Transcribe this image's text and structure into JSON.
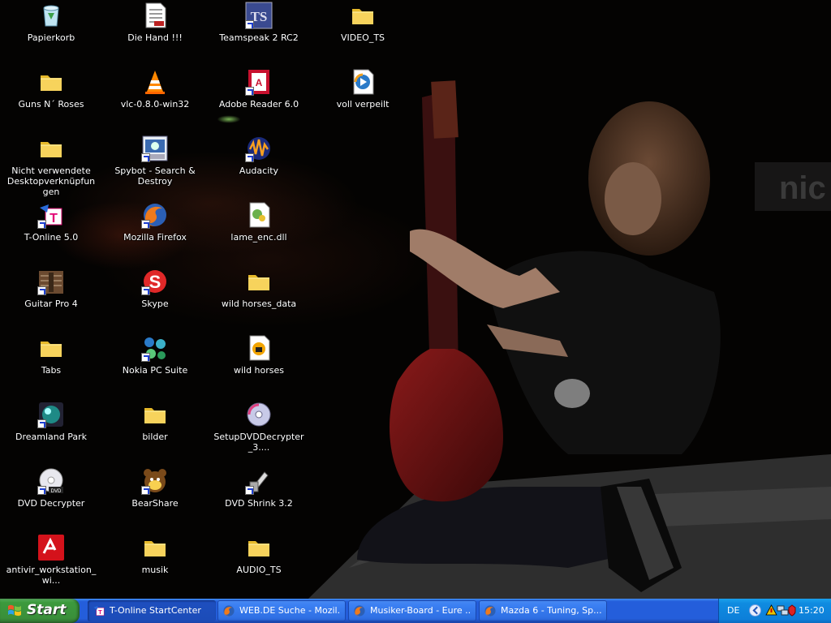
{
  "desktop": {
    "icons": [
      {
        "id": "papierkorb",
        "label": "Papierkorb",
        "icon": "recycle-bin-icon"
      },
      {
        "id": "guns-n-roses",
        "label": "Guns N´ Roses",
        "icon": "folder-icon"
      },
      {
        "id": "nicht-verwendete",
        "label": "Nicht verwendete Desktopverknüpfungen",
        "icon": "folder-icon"
      },
      {
        "id": "t-online",
        "label": "T-Online 5.0",
        "icon": "t-online-icon"
      },
      {
        "id": "guitar-pro",
        "label": "Guitar Pro 4",
        "icon": "guitar-pro-icon"
      },
      {
        "id": "tabs",
        "label": "Tabs",
        "icon": "folder-icon"
      },
      {
        "id": "dreamland-park",
        "label": "Dreamland Park",
        "icon": "game-icon"
      },
      {
        "id": "dvd-decrypter",
        "label": "DVD Decrypter",
        "icon": "dvd-icon"
      },
      {
        "id": "antivir",
        "label": "antivir_workstation_wi...",
        "icon": "antivir-icon"
      },
      {
        "id": "die-hand",
        "label": "Die Hand !!!",
        "icon": "document-icon"
      },
      {
        "id": "vlc",
        "label": "vlc-0.8.0-win32",
        "icon": "vlc-cone-icon"
      },
      {
        "id": "spybot",
        "label": "Spybot - Search & Destroy",
        "icon": "spybot-icon"
      },
      {
        "id": "firefox",
        "label": "Mozilla Firefox",
        "icon": "firefox-icon"
      },
      {
        "id": "skype",
        "label": "Skype",
        "icon": "skype-icon"
      },
      {
        "id": "nokia",
        "label": "Nokia PC Suite",
        "icon": "nokia-icon"
      },
      {
        "id": "bilder",
        "label": "bilder",
        "icon": "folder-icon"
      },
      {
        "id": "bearshare",
        "label": "BearShare",
        "icon": "bearshare-icon"
      },
      {
        "id": "musik",
        "label": "musik",
        "icon": "folder-icon"
      },
      {
        "id": "teamspeak",
        "label": "Teamspeak 2 RC2",
        "icon": "teamspeak-icon"
      },
      {
        "id": "adobe-reader",
        "label": "Adobe Reader 6.0",
        "icon": "adobe-reader-icon"
      },
      {
        "id": "audacity",
        "label": "Audacity",
        "icon": "audacity-icon"
      },
      {
        "id": "lame-enc",
        "label": "lame_enc.dll",
        "icon": "dll-file-icon"
      },
      {
        "id": "wild-horses-data",
        "label": "wild horses_data",
        "icon": "folder-icon"
      },
      {
        "id": "wild-horses",
        "label": "wild horses",
        "icon": "audio-file-icon"
      },
      {
        "id": "setup-dvd",
        "label": "SetupDVDDecrypter_3....",
        "icon": "cd-setup-icon"
      },
      {
        "id": "dvd-shrink",
        "label": "DVD Shrink 3.2",
        "icon": "dvd-shrink-icon"
      },
      {
        "id": "audio-ts",
        "label": "AUDIO_TS",
        "icon": "folder-icon"
      },
      {
        "id": "video-ts",
        "label": "VIDEO_TS",
        "icon": "folder-icon"
      },
      {
        "id": "voll-verpeilt",
        "label": "voll verpeilt",
        "icon": "media-file-icon"
      }
    ]
  },
  "taskbar": {
    "start_label": "Start",
    "tasks": [
      {
        "label": "T-Online StartCenter",
        "icon": "t-online-icon",
        "active": true
      },
      {
        "label": "WEB.DE Suche - Mozil...",
        "icon": "firefox-icon",
        "active": false
      },
      {
        "label": "Musiker-Board - Eure ...",
        "icon": "firefox-icon",
        "active": false
      },
      {
        "label": "Mazda 6 - Tuning, Sp...",
        "icon": "firefox-icon",
        "active": false
      }
    ],
    "tray": {
      "language": "DE",
      "clock": "15:20",
      "icons": [
        "show-hidden-icons-arrow",
        "antivir-tray-icon",
        "network-icon",
        "security-icon"
      ]
    }
  },
  "colors": {
    "taskbar": "#245edb",
    "start": "#3c9a3d",
    "tray": "#0f8be0"
  }
}
